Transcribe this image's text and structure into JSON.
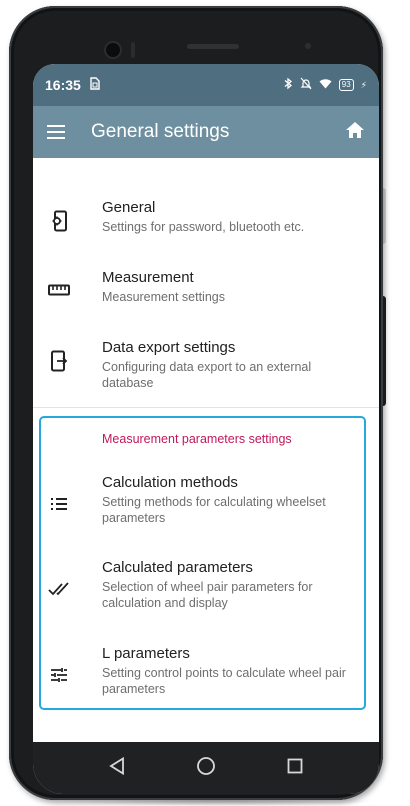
{
  "status_bar": {
    "time": "16:35",
    "sim_icon": "sim-icon",
    "icons": [
      "bluetooth-icon",
      "bell-off-icon",
      "wifi-icon"
    ],
    "battery": "93"
  },
  "app_bar": {
    "title": "General settings",
    "menu_icon": "menu-icon",
    "home_icon": "home-icon",
    "color": "#6d8f9f"
  },
  "items": [
    {
      "title": "General",
      "subtitle": "Settings for password, bluetooth etc.",
      "icon": "settings-export-icon"
    },
    {
      "title": "Measurement",
      "subtitle": "Measurement settings",
      "icon": "ruler-icon"
    },
    {
      "title": "Data export settings",
      "subtitle": "Configuring data export to an external database",
      "icon": "phone-export-icon"
    }
  ],
  "section": {
    "header": "Measurement parameters settings",
    "header_color": "#c2185b",
    "highlight_color": "#27a8dc",
    "items": [
      {
        "title": "Calculation methods",
        "subtitle": "Setting methods for calculating wheelset parameters",
        "icon": "list-icon"
      },
      {
        "title": "Calculated parameters",
        "subtitle": "Selection of wheel pair parameters for calculation and display",
        "icon": "double-check-icon"
      },
      {
        "title": "L parameters",
        "subtitle": "Setting control points to calculate wheel pair parameters",
        "icon": "tune-icon"
      }
    ]
  },
  "nav_bar": {
    "buttons": [
      "back-icon",
      "home-circle-icon",
      "recents-icon"
    ]
  }
}
